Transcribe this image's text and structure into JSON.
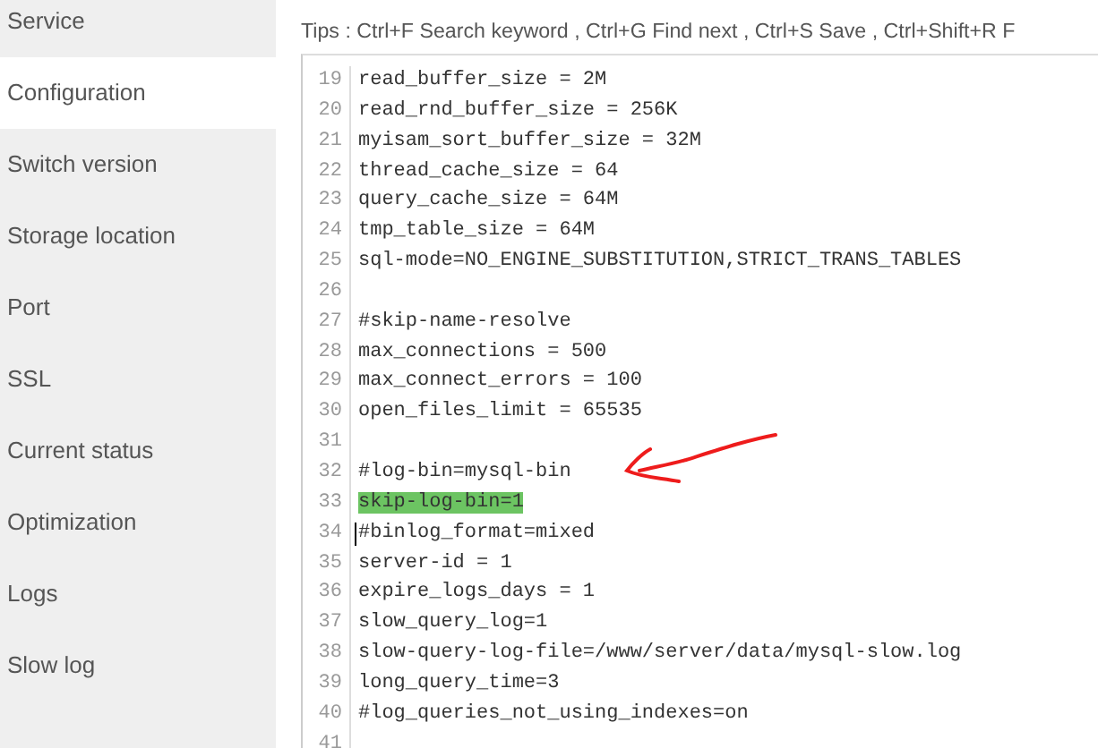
{
  "sidebar": {
    "items": [
      {
        "label": "Service",
        "selected": false
      },
      {
        "label": "Configuration",
        "selected": true
      },
      {
        "label": "Switch version",
        "selected": false
      },
      {
        "label": "Storage location",
        "selected": false
      },
      {
        "label": "Port",
        "selected": false
      },
      {
        "label": "SSL",
        "selected": false
      },
      {
        "label": "Current status",
        "selected": false
      },
      {
        "label": "Optimization",
        "selected": false
      },
      {
        "label": "Logs",
        "selected": false
      },
      {
        "label": "Slow log",
        "selected": false
      }
    ]
  },
  "tips": "Tips : Ctrl+F Search keyword , Ctrl+G Find next , Ctrl+S Save , Ctrl+Shift+R F",
  "editor": {
    "lines": [
      {
        "number": "19",
        "text": "read_buffer_size = 2M",
        "highlighted": false,
        "cursor": false
      },
      {
        "number": "20",
        "text": "read_rnd_buffer_size = 256K",
        "highlighted": false,
        "cursor": false
      },
      {
        "number": "21",
        "text": "myisam_sort_buffer_size = 32M",
        "highlighted": false,
        "cursor": false
      },
      {
        "number": "22",
        "text": "thread_cache_size = 64",
        "highlighted": false,
        "cursor": false
      },
      {
        "number": "23",
        "text": "query_cache_size = 64M",
        "highlighted": false,
        "cursor": false
      },
      {
        "number": "24",
        "text": "tmp_table_size = 64M",
        "highlighted": false,
        "cursor": false
      },
      {
        "number": "25",
        "text": "sql-mode=NO_ENGINE_SUBSTITUTION,STRICT_TRANS_TABLES",
        "highlighted": false,
        "cursor": false
      },
      {
        "number": "26",
        "cursor": false
      },
      {
        "number": "27",
        "text": "#skip-name-resolve",
        "highlighted": false,
        "cursor": false
      },
      {
        "number": "28",
        "text": "max_connections = 500",
        "highlighted": false,
        "cursor": false
      },
      {
        "number": "29",
        "text": "max_connect_errors = 100",
        "highlighted": false,
        "cursor": false
      },
      {
        "number": "30",
        "text": "open_files_limit = 65535",
        "highlighted": false,
        "cursor": false
      },
      {
        "number": "31",
        "cursor": false
      },
      {
        "number": "32",
        "text": "#log-bin=mysql-bin",
        "highlighted": false,
        "cursor": false
      },
      {
        "number": "33",
        "text": "skip-log-bin=1",
        "highlighted": true,
        "cursor": false
      },
      {
        "number": "34",
        "text": "#binlog_format=mixed",
        "highlighted": false,
        "cursor": true
      },
      {
        "number": "35",
        "text": "server-id = 1",
        "highlighted": false,
        "cursor": false
      },
      {
        "number": "36",
        "text": "expire_logs_days = 1",
        "highlighted": false,
        "cursor": false
      },
      {
        "number": "37",
        "text": "slow_query_log=1",
        "highlighted": false,
        "cursor": false
      },
      {
        "number": "38",
        "text": "slow-query-log-file=/www/server/data/mysql-slow.log",
        "highlighted": false,
        "cursor": false
      },
      {
        "number": "39",
        "text": "long_query_time=3",
        "highlighted": false,
        "cursor": false
      },
      {
        "number": "40",
        "text": "#log_queries_not_using_indexes=on",
        "highlighted": false,
        "cursor": false
      },
      {
        "number": "41",
        "cursor": false
      }
    ]
  }
}
